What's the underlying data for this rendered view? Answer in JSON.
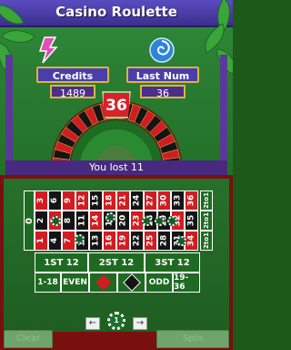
{
  "header": {
    "title": "Casino Roulette"
  },
  "stats": {
    "credits_label": "Credits",
    "credits_value": "1489",
    "last_num_label": "Last Num",
    "last_num_value": "36"
  },
  "wheel": {
    "result_number": "36",
    "result_color": "#d6232a"
  },
  "status": {
    "message": "You lost 11"
  },
  "board": {
    "zero": "0",
    "rows": [
      {
        "label_color": "top",
        "cells": [
          "3",
          "6",
          "9",
          "12",
          "15",
          "18",
          "21",
          "24",
          "27",
          "30",
          "33",
          "36"
        ],
        "colors": [
          "red",
          "black",
          "red",
          "red",
          "black",
          "red",
          "red",
          "black",
          "red",
          "red",
          "black",
          "red"
        ]
      },
      {
        "label_color": "mid",
        "cells": [
          "2",
          "5",
          "8",
          "11",
          "14",
          "17",
          "20",
          "23",
          "26",
          "29",
          "32",
          "35"
        ],
        "colors": [
          "black",
          "red",
          "black",
          "black",
          "red",
          "black",
          "black",
          "red",
          "black",
          "black",
          "red",
          "black"
        ]
      },
      {
        "label_color": "bot",
        "cells": [
          "1",
          "4",
          "7",
          "10",
          "13",
          "16",
          "19",
          "22",
          "25",
          "28",
          "31",
          "34"
        ],
        "colors": [
          "red",
          "black",
          "red",
          "black",
          "black",
          "red",
          "red",
          "black",
          "red",
          "black",
          "black",
          "red"
        ]
      }
    ],
    "column_bets": [
      "2to1",
      "2to1",
      "2to1"
    ],
    "dozens": [
      "1ST 12",
      "2ST 12",
      "3ST 12"
    ],
    "even_bets": [
      "1-18",
      "EVEN",
      "",
      "",
      "ODD",
      "19-36"
    ]
  },
  "controls": {
    "prev_arrow": "←",
    "next_arrow": "→",
    "chip_value": "1",
    "left_button": "Clear",
    "right_button": "Spin"
  },
  "colors": {
    "red": "#d11d22",
    "black": "#141414",
    "felt": "#1f6a22",
    "frame": "#7a0f10",
    "accent_gold": "#d8b541",
    "banner": "#4a3fa8"
  }
}
